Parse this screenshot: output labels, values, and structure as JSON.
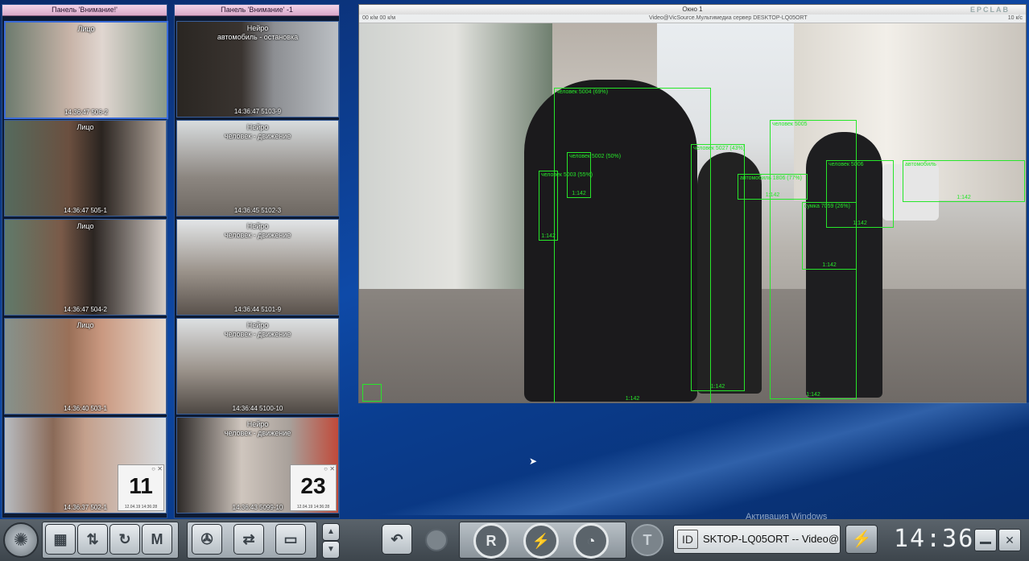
{
  "panel_left": {
    "title": "Панель 'Внимание!'",
    "tiles": [
      {
        "kind": "Лицо",
        "stamp": "14:36:47 506-2"
      },
      {
        "kind": "Лицо",
        "stamp": "14:36:47 505-1"
      },
      {
        "kind": "Лицо",
        "stamp": "14:36:47 504-2"
      },
      {
        "kind": "Лицо",
        "stamp": "14:36:40 503-1"
      },
      {
        "kind": "",
        "stamp": "14:36:37 502-1"
      }
    ],
    "counter": {
      "value": "11",
      "date": "12.04.19 14:36:28"
    }
  },
  "panel_right": {
    "title": "Панель 'Внимание' -1",
    "tiles": [
      {
        "kind": "Нейро\nавтомобиль - остановка",
        "stamp": "14:36:47 5103-9"
      },
      {
        "kind": "Нейро\nчеловек - движение",
        "stamp": "14:36:45 5102-3"
      },
      {
        "kind": "Нейро\nчеловек - движение",
        "stamp": "14:36:44 5101-9"
      },
      {
        "kind": "Нейро\nчеловек - движение",
        "stamp": "14:36:44 5100-10"
      },
      {
        "kind": "Нейро\nчеловек - движение",
        "stamp": "14:36:43 5099-10"
      }
    ],
    "counter": {
      "value": "23",
      "date": "12.04.19 14:36:28"
    }
  },
  "video_window": {
    "title": "Окно 1",
    "brand": "EPCLAB",
    "info_left": "00 к/м   00 к/м",
    "info_center": "Video@VicSource.Мультимедиа сервер DESKTOP-LQ05ORT",
    "info_right": "10 к/с"
  },
  "detections": [
    {
      "label": "человек 5004 (69%)",
      "track": "1:142"
    },
    {
      "label": "человек 5002 (50%)",
      "track": "1:142"
    },
    {
      "label": "человек 5003 (55%)",
      "track": "1:142"
    },
    {
      "label": "человек 5027 (43%)",
      "track": "1:142"
    },
    {
      "label": "человек 5005",
      "track": "1:142"
    },
    {
      "label": "автомобиль 1806 (77%)",
      "track": "1:142"
    },
    {
      "label": "сумка 7059 (26%)",
      "track": "1:142"
    },
    {
      "label": "человек 5006",
      "track": "1:142"
    },
    {
      "label": "автомобиль",
      "track": "1:142"
    }
  ],
  "windows_activation": "Активация Windows",
  "taskbar": {
    "m_label": "M",
    "r_label": "R",
    "t_label": "T",
    "id_label": "ID",
    "source_field": "SKTOP-LQ05ORT -- Video@",
    "clock": "14:36"
  },
  "colors": {
    "detection": "#27e62a",
    "panel_title": "#f3d4e8"
  }
}
